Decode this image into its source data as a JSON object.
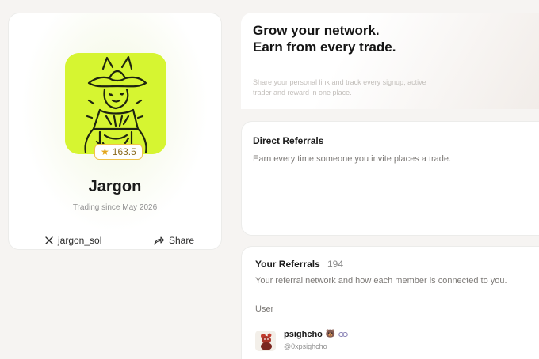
{
  "profile": {
    "name": "Jargon",
    "rating": "163.5",
    "since": "Trading since May 2026",
    "x_handle": "jargon_sol",
    "share_label": "Share",
    "accent": "#d6f531"
  },
  "hero": {
    "title_line1": "Grow your network.",
    "title_line2": "Earn from every trade.",
    "subtitle": "Share your personal link and track every signup, active trader and reward in one place."
  },
  "direct_referrals": {
    "title": "Direct Referrals",
    "description": "Earn every time someone you invite places a trade."
  },
  "your_referrals": {
    "title": "Your Referrals",
    "count": "194",
    "description": "Your referral network and how each member is connected to you.",
    "column_user": "User",
    "rows": [
      {
        "name": "psighcho",
        "name_emoji": "🐻",
        "handle": "@0xpsighcho",
        "icon": "chain-link-icon"
      }
    ]
  }
}
